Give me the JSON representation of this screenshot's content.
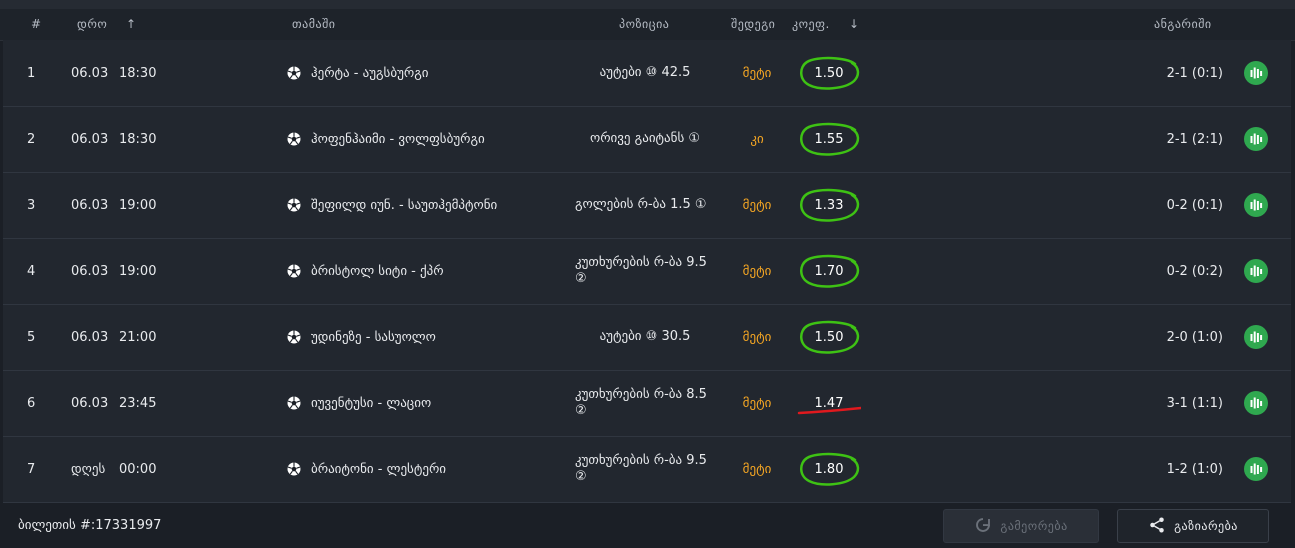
{
  "header": {
    "num": "#",
    "time": "დრო",
    "game": "თამაში",
    "position": "პოზიცია",
    "outcome": "შედეგი",
    "odds": "კოეფ.",
    "result": "ანგარიში",
    "sort_up_icon": "arrow-up-icon",
    "sort_down_icon": "arrow-down-icon"
  },
  "rows": [
    {
      "num": "1",
      "date": "06.03",
      "time": "18:30",
      "game": "ჰერტა - აუგსბურგი",
      "position": "აუტები ⑩ 42.5",
      "outcome": "მეტი",
      "odds": "1.50",
      "mark": "won",
      "result": "2-1 (0:1)"
    },
    {
      "num": "2",
      "date": "06.03",
      "time": "18:30",
      "game": "ჰოფენჰაიმი - ვოლფსბურგი",
      "position": "ორივე გაიტანს ①",
      "outcome": "კი",
      "odds": "1.55",
      "mark": "won",
      "result": "2-1 (2:1)"
    },
    {
      "num": "3",
      "date": "06.03",
      "time": "19:00",
      "game": "შეფილდ იუნ. - საუთჰემპტონი",
      "position": "გოლების რ-ბა 1.5 ①",
      "outcome": "მეტი",
      "odds": "1.33",
      "mark": "won",
      "result": "0-2 (0:1)"
    },
    {
      "num": "4",
      "date": "06.03",
      "time": "19:00",
      "game": "ბრისტოლ სიტი - ქპრ",
      "position": "კუთხურების რ-ბა 9.5 ②",
      "outcome": "მეტი",
      "odds": "1.70",
      "mark": "won",
      "result": "0-2 (0:2)"
    },
    {
      "num": "5",
      "date": "06.03",
      "time": "21:00",
      "game": "უდინეზე - სასუოლო",
      "position": "აუტები ⑩ 30.5",
      "outcome": "მეტი",
      "odds": "1.50",
      "mark": "won",
      "result": "2-0 (1:0)"
    },
    {
      "num": "6",
      "date": "06.03",
      "time": "23:45",
      "game": "იუვენტუსი - ლაციო",
      "position": "კუთხურების რ-ბა 8.5 ②",
      "outcome": "მეტი",
      "odds": "1.47",
      "mark": "lost",
      "result": "3-1 (1:1)"
    },
    {
      "num": "7",
      "date": "დღეს",
      "time": "00:00",
      "game": "ბრაიტონი - ლესტერი",
      "position": "კუთხურების რ-ბა 9.5 ②",
      "outcome": "მეტი",
      "odds": "1.80",
      "mark": "won",
      "result": "1-2 (1:0)"
    }
  ],
  "footer": {
    "ticket": "ბილეთის #:17331997",
    "repeat_label": "გამეორება",
    "share_label": "გაზიარება"
  },
  "colors": {
    "won_circle": "#3ec214",
    "lost_line": "#e0191e",
    "outcome_text": "#f5a623",
    "stats_button": "#2fa84f"
  },
  "icons": {
    "sport": "soccer-ball-icon",
    "stats": "stats-bars-icon",
    "repeat": "repeat-icon",
    "share": "share-icon"
  }
}
